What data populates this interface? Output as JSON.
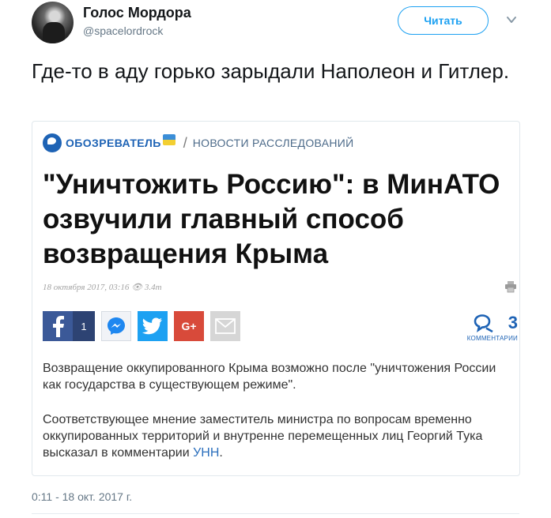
{
  "tweet": {
    "author_name": "Голос Мордора",
    "author_handle": "@spacelordrock",
    "follow_label": "Читать",
    "text": "Где-то в аду горько зарыдали Наполеон и Гитлер.",
    "timestamp": "0:11 - 18 окт. 2017 г."
  },
  "card": {
    "site_name": "ОБОЗРЕВАТЕЛЬ",
    "section": "НОВОСТИ РАССЛЕДОВАНИЙ",
    "headline": "\"Уничтожить Россию\": в МинАТО озвучили главный способ возвращения Крыма",
    "date": "18 октября 2017, 03:16",
    "views": "3.4т",
    "share": {
      "facebook_count": "1",
      "googleplus_label": "G+"
    },
    "comments_count": "3",
    "comments_label": "КОММЕНТАРИИ",
    "paragraph1": "Возвращение оккупированного Крыма возможно после \"уничтожения России как государства в существующем режиме\".",
    "paragraph2_prefix": "Соответствующее мнение заместитель министра по вопросам временно оккупированных территорий и внутренне перемещенных лиц Георгий Тука высказал в комментарии ",
    "paragraph2_link": "УНН",
    "paragraph2_suffix": "."
  },
  "colors": {
    "twitter_blue": "#1da1f2",
    "site_blue": "#1e63b5",
    "facebook": "#3b5998",
    "googleplus": "#d84a3a"
  },
  "icons": [
    "avatar",
    "chevron-down-icon",
    "globe-logo-icon",
    "print-icon",
    "facebook-icon",
    "messenger-icon",
    "twitter-icon",
    "googleplus-icon",
    "mail-icon",
    "comments-icon"
  ]
}
